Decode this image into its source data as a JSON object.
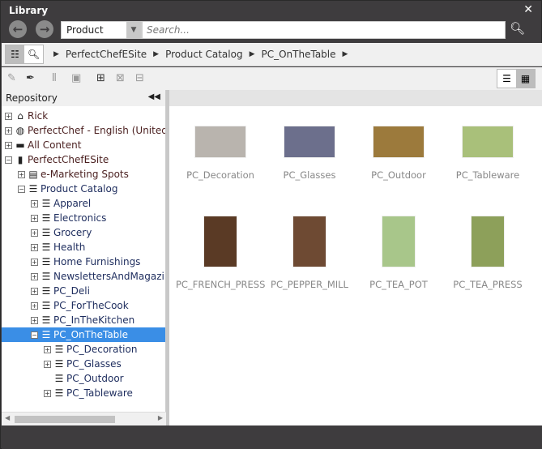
{
  "window": {
    "title": "Library",
    "close": "✕"
  },
  "nav": {
    "back": "←",
    "forward": "→",
    "scope": "Product",
    "search_placeholder": "Search..."
  },
  "breadcrumb": [
    "PerfectChefESite",
    "Product Catalog",
    "PC_OnTheTable"
  ],
  "panel": {
    "title": "Repository"
  },
  "tree": [
    {
      "label": "Rick",
      "icon": "home-icon",
      "glyph": "⌂",
      "depth": 0,
      "exp": "+"
    },
    {
      "label": "PerfectChef - English (United States)",
      "icon": "globe-icon",
      "glyph": "◍",
      "depth": 0,
      "exp": "+"
    },
    {
      "label": "All Content",
      "icon": "folder-icon",
      "glyph": "▬",
      "depth": 0,
      "exp": "+"
    },
    {
      "label": "PerfectChefESite",
      "icon": "site-icon",
      "glyph": "▮",
      "depth": 0,
      "exp": "−"
    },
    {
      "label": "e-Marketing Spots",
      "icon": "espot-icon",
      "glyph": "▤",
      "depth": 1,
      "exp": "+"
    },
    {
      "label": "Product Catalog",
      "icon": "catalog-icon",
      "glyph": "☰",
      "depth": 1,
      "exp": "−"
    },
    {
      "label": "Apparel",
      "icon": "category-icon",
      "glyph": "☰",
      "depth": 2,
      "exp": "+"
    },
    {
      "label": "Electronics",
      "icon": "category-icon",
      "glyph": "☰",
      "depth": 2,
      "exp": "+"
    },
    {
      "label": "Grocery",
      "icon": "category-icon",
      "glyph": "☰",
      "depth": 2,
      "exp": "+"
    },
    {
      "label": "Health",
      "icon": "category-icon",
      "glyph": "☰",
      "depth": 2,
      "exp": "+"
    },
    {
      "label": "Home Furnishings",
      "icon": "category-icon",
      "glyph": "☰",
      "depth": 2,
      "exp": "+"
    },
    {
      "label": "NewslettersAndMagazines",
      "icon": "category-icon",
      "glyph": "☰",
      "depth": 2,
      "exp": "+"
    },
    {
      "label": "PC_Deli",
      "icon": "category-icon",
      "glyph": "☰",
      "depth": 2,
      "exp": "+"
    },
    {
      "label": "PC_ForTheCook",
      "icon": "category-icon",
      "glyph": "☰",
      "depth": 2,
      "exp": "+"
    },
    {
      "label": "PC_InTheKitchen",
      "icon": "category-icon",
      "glyph": "☰",
      "depth": 2,
      "exp": "+"
    },
    {
      "label": "PC_OnTheTable",
      "icon": "category-icon",
      "glyph": "☰",
      "depth": 2,
      "exp": "−",
      "selected": true
    },
    {
      "label": "PC_Decoration",
      "icon": "category-icon",
      "glyph": "☰",
      "depth": 3,
      "exp": "+"
    },
    {
      "label": "PC_Glasses",
      "icon": "category-icon",
      "glyph": "☰",
      "depth": 3,
      "exp": "+"
    },
    {
      "label": "PC_Outdoor",
      "icon": "category-icon",
      "glyph": "☰",
      "depth": 3,
      "exp": ""
    },
    {
      "label": "PC_Tableware",
      "icon": "category-icon",
      "glyph": "☰",
      "depth": 3,
      "exp": "+"
    }
  ],
  "items": [
    {
      "label": "PC_Decoration",
      "color": "#b9b4ae",
      "shape": "wide"
    },
    {
      "label": "PC_Glasses",
      "color": "#6c6f8c",
      "shape": "wide"
    },
    {
      "label": "PC_Outdoor",
      "color": "#9c7a3c",
      "shape": "wide"
    },
    {
      "label": "PC_Tableware",
      "color": "#a9c07a",
      "shape": "wide"
    },
    {
      "label": "PC_FRENCH_PRESS",
      "color": "#5a3a25",
      "shape": "tall"
    },
    {
      "label": "PC_PEPPER_MILL",
      "color": "#6e4a33",
      "shape": "tall"
    },
    {
      "label": "PC_TEA_POT",
      "color": "#a8c68a",
      "shape": "tall"
    },
    {
      "label": "PC_TEA_PRESS",
      "color": "#8da05a",
      "shape": "tall"
    }
  ]
}
